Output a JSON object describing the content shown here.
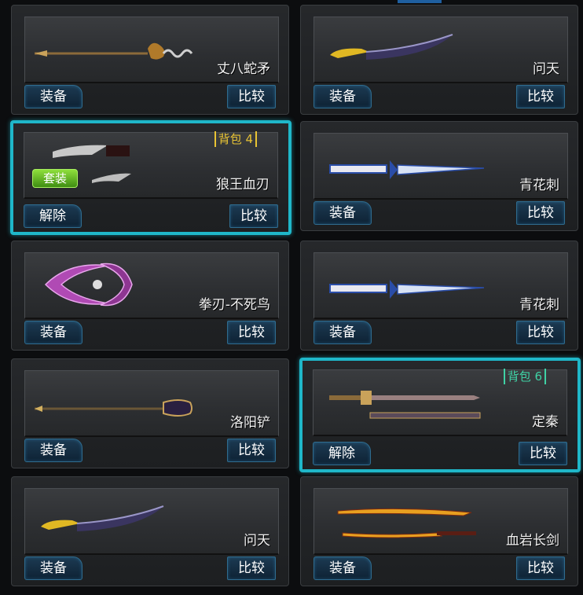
{
  "items": [
    {
      "name": "丈八蛇矛",
      "action": "装备",
      "compare": "比较",
      "weapon_icon": "serpent-spear-icon"
    },
    {
      "name": "问天",
      "action": "装备",
      "compare": "比较",
      "weapon_icon": "curved-blade-icon"
    },
    {
      "name": "狼王血刃",
      "action": "解除",
      "compare": "比较",
      "bag": "背包 4",
      "bag_color": "#e8c334",
      "suit": "套装",
      "selected": true,
      "weapon_icon": "twin-wolf-blades-icon"
    },
    {
      "name": "青花刺",
      "action": "装备",
      "compare": "比较",
      "weapon_icon": "porcelain-dagger-icon"
    },
    {
      "name": "拳刃-不死鸟",
      "action": "装备",
      "compare": "比较",
      "weapon_icon": "phoenix-claw-icon"
    },
    {
      "name": "青花刺",
      "action": "装备",
      "compare": "比较",
      "weapon_icon": "porcelain-dagger-icon"
    },
    {
      "name": "洛阳铲",
      "action": "装备",
      "compare": "比较",
      "weapon_icon": "luoyang-shovel-icon"
    },
    {
      "name": "定秦",
      "action": "解除",
      "compare": "比较",
      "bag": "背包 6",
      "bag_color": "#3fd2a5",
      "selected": true,
      "weapon_icon": "dingqin-sword-icon"
    },
    {
      "name": "问天",
      "action": "装备",
      "compare": "比较",
      "weapon_icon": "curved-blade-icon"
    },
    {
      "name": "血岩长剑",
      "action": "装备",
      "compare": "比较",
      "weapon_icon": "lava-longsword-icon"
    }
  ],
  "colors": {
    "selected_border": "#1fb7c9",
    "button_border": "#2f6c8f"
  }
}
